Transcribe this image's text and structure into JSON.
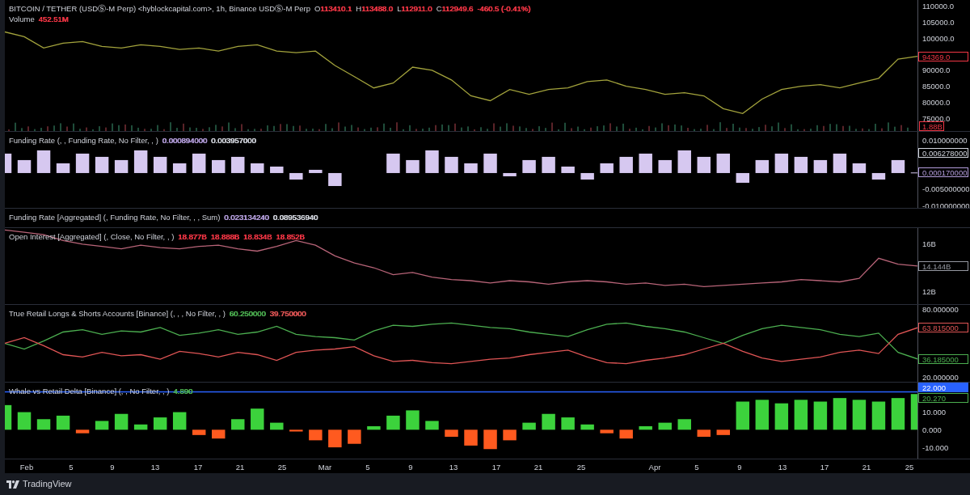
{
  "panes": [
    {
      "kind": "price",
      "legend": {
        "title": "BITCOIN / TETHER (USDⓈ-M Perp) <hyblockcapital.com>, 1h, Binance USDⓈ-M Perp",
        "values": [
          {
            "label": "O",
            "text": "113410.1",
            "color": "#f23645"
          },
          {
            "label": "H",
            "text": "113488.0",
            "color": "#f23645"
          },
          {
            "label": "L",
            "text": "112911.0",
            "color": "#f23645"
          },
          {
            "label": "C",
            "text": "112949.6",
            "color": "#f23645"
          },
          {
            "text": "-460.5 (-0.41%)",
            "color": "#f23645"
          }
        ]
      },
      "volume": {
        "title": "Volume",
        "value": "452.51M",
        "color": "#f23645",
        "badge": "1.88B"
      },
      "badges": [
        {
          "color": "#f23645"
        }
      ],
      "chart_data": {
        "type": "line",
        "ylim": [
          71000,
          112000
        ],
        "yticks": [
          {
            "value": 110000,
            "label": "110000.0"
          },
          {
            "value": 105000,
            "label": "105000.0"
          },
          {
            "value": 100000,
            "label": "100000.0"
          },
          {
            "value": 90000,
            "label": "90000.0"
          },
          {
            "value": 85000,
            "label": "85000.0"
          },
          {
            "value": 80000,
            "label": "80000.0"
          },
          {
            "value": 75000,
            "label": "75000.0"
          }
        ],
        "series": [
          {
            "color": "#a3a33c",
            "values": [
              102000,
              100500,
              97000,
              98500,
              99000,
              97500,
              97000,
              98000,
              97500,
              96500,
              97000,
              96000,
              97500,
              98000,
              96000,
              95500,
              96000,
              91500,
              88000,
              84500,
              86000,
              91000,
              90000,
              87000,
              82000,
              80500,
              84000,
              82500,
              84000,
              84500,
              86500,
              87000,
              85000,
              84000,
              82500,
              83000,
              82000,
              78000,
              76500,
              81000,
              84000,
              85000,
              85500,
              84500,
              86000,
              87500,
              93500,
              94369
            ]
          }
        ],
        "annotations": [
          "94369.0"
        ]
      }
    },
    {
      "kind": "bars",
      "legend": {
        "title": "Funding Rate (, , Funding Rate, No Filter, , )",
        "values": [
          {
            "text": "0.000894000",
            "color": "#b39ddb"
          },
          {
            "text": "0.003957000",
            "color": "#d1d4dc"
          }
        ]
      },
      "badges": [
        {
          "color": "#b39ddb"
        },
        {
          "color": "#d1d4dc"
        }
      ],
      "chart_data": {
        "type": "bar",
        "ylim": [
          -0.010741,
          0.012716
        ],
        "yticks": [
          {
            "value": 0.01,
            "label": "0.010000000"
          },
          {
            "value": -0.005,
            "label": "-0.005000000"
          },
          {
            "value": -0.01,
            "label": "-0.010000000"
          }
        ],
        "series": [
          {
            "color": "#d6c8f0",
            "values": [
              0.006,
              0.004,
              0.007,
              0.003,
              0.006,
              0.005,
              0.004,
              0.007,
              0.005,
              0.003,
              0.006,
              0.004,
              0.005,
              0.003,
              0.002,
              -0.002,
              0.001,
              -0.004,
              null,
              null,
              0.006,
              0.004,
              0.007,
              0.005,
              0.003,
              0.006,
              -0.001,
              0.004,
              0.005,
              0.002,
              -0.002,
              0.003,
              0.005,
              0.006,
              0.004,
              0.007,
              0.005,
              0.006,
              -0.003,
              0.004,
              0.006,
              0.005,
              0.004,
              0.006,
              0.003,
              -0.002,
              0.004,
              0.00017
            ]
          }
        ],
        "annotations": [
          "0.000170000",
          "0.006278000"
        ]
      }
    },
    {
      "kind": "legend",
      "legend": {
        "title": "Funding Rate [Aggregated] (, Funding Rate, No Filter, , , Sum)",
        "values": [
          {
            "text": "0.023134240",
            "color": "#b39ddb"
          },
          {
            "text": "0.089536940",
            "color": "#d1d4dc"
          }
        ]
      }
    },
    {
      "kind": "lines",
      "legend": {
        "title": "Open Interest [Aggregated] (, Close, No Filter, , )",
        "values": [
          {
            "text": "18.877B",
            "color": "#f23645"
          },
          {
            "text": "18.888B",
            "color": "#f23645"
          },
          {
            "text": "18.834B",
            "color": "#f23645"
          },
          {
            "text": "18.852B",
            "color": "#f23645"
          }
        ]
      },
      "badges": [
        {
          "color": "#9598a1"
        }
      ],
      "chart_data": {
        "type": "line",
        "ylim": [
          10.915,
          17.356
        ],
        "yticks": [
          {
            "value": 16,
            "label": "16B"
          },
          {
            "value": 12,
            "label": "12B"
          }
        ],
        "series": [
          {
            "color": "#b86478",
            "values": [
              17.2,
              17.0,
              16.8,
              16.3,
              16.0,
              15.8,
              15.6,
              15.9,
              15.7,
              15.6,
              15.8,
              15.9,
              15.6,
              15.4,
              15.8,
              16.3,
              15.9,
              15.0,
              14.4,
              14.0,
              13.4,
              13.6,
              13.2,
              13.0,
              12.9,
              12.7,
              12.9,
              12.8,
              12.6,
              12.8,
              12.9,
              12.8,
              12.6,
              12.7,
              12.5,
              12.6,
              12.4,
              12.5,
              12.6,
              12.7,
              12.8,
              13.0,
              12.9,
              12.8,
              13.1,
              14.8,
              14.3,
              14.144
            ]
          }
        ],
        "annotations": [
          "14.144B"
        ]
      }
    },
    {
      "kind": "lines",
      "legend": {
        "title": "True Retail Longs & Shorts Accounts [Binance] (, , , No Filter, , )",
        "values": [
          {
            "text": "60.250000",
            "color": "#4caf50"
          },
          {
            "text": "39.750000",
            "color": "#e05555"
          }
        ]
      },
      "badges": [
        {
          "color": "#4caf50"
        },
        {
          "color": "#e05555"
        }
      ],
      "chart_data": {
        "type": "line",
        "ylim": [
          16,
          84
        ],
        "yticks": [
          {
            "value": 80,
            "label": "80.000000"
          },
          {
            "value": 20,
            "label": "20.000000"
          }
        ],
        "series": [
          {
            "color": "#4caf50",
            "values": [
              50,
              45,
              52,
              60,
              62,
              58,
              61,
              60,
              64,
              57,
              59,
              62,
              58,
              60,
              65,
              58,
              56,
              55,
              53,
              61,
              66,
              65,
              67,
              68,
              66,
              64,
              63,
              60,
              58,
              56,
              62,
              67,
              68,
              65,
              63,
              60,
              55,
              50,
              57,
              63,
              66,
              64,
              62,
              58,
              56,
              59,
              42,
              36.185
            ]
          },
          {
            "color": "#e05555",
            "values": [
              50,
              55,
              48,
              40,
              38,
              42,
              39,
              40,
              36,
              43,
              41,
              38,
              42,
              40,
              35,
              42,
              44,
              45,
              47,
              39,
              34,
              35,
              33,
              32,
              34,
              36,
              37,
              40,
              42,
              44,
              38,
              33,
              32,
              35,
              37,
              40,
              45,
              50,
              43,
              37,
              34,
              36,
              38,
              42,
              44,
              41,
              58,
              63.815
            ]
          }
        ],
        "annotations": [
          "36.185000",
          "63.815000"
        ]
      }
    },
    {
      "kind": "bars",
      "legend": {
        "title": "Whale vs Retail Delta [Binance] (, , No Filter, , )",
        "values": [
          {
            "text": "4.890",
            "color": "#4caf50"
          }
        ]
      },
      "badges": [
        {
          "color": "#4caf50"
        }
      ],
      "chart_data": {
        "type": "bar",
        "ylim": [
          -16.4,
          26.8
        ],
        "yticks": [
          {
            "value": 10,
            "label": "10.000"
          },
          {
            "value": 0,
            "label": "0.000"
          },
          {
            "value": -10,
            "label": "-10.000"
          }
        ],
        "series": [
          {
            "color": "#3cd23c",
            "values": [
              14,
              10,
              6,
              8,
              null,
              5,
              9,
              3,
              7,
              10,
              null,
              null,
              6,
              12,
              4,
              null,
              null,
              null,
              null,
              2,
              8,
              11,
              5,
              null,
              null,
              null,
              null,
              4,
              9,
              7,
              3,
              null,
              null,
              2,
              4,
              6,
              null,
              null,
              16,
              17,
              15,
              17,
              16,
              18,
              17,
              16,
              18,
              20.27
            ]
          },
          {
            "color": "#ff5a1f",
            "values": [
              null,
              null,
              null,
              null,
              -2,
              null,
              null,
              null,
              null,
              null,
              -3,
              -5,
              null,
              null,
              null,
              -1,
              -6,
              -10,
              -8,
              null,
              null,
              null,
              null,
              -4,
              -9,
              -11,
              -6,
              null,
              null,
              null,
              null,
              -2,
              -5,
              null,
              null,
              null,
              -4,
              -3,
              null,
              null,
              null,
              null,
              null,
              null,
              null,
              null,
              null,
              null
            ]
          }
        ],
        "annotations": [
          "20.270"
        ]
      },
      "alert": {
        "label": "22.000",
        "color": "#2962ff"
      }
    }
  ],
  "time_axis": {
    "labels": [
      "Feb",
      "5",
      "9",
      "13",
      "17",
      "21",
      "25",
      "Mar",
      "5",
      "9",
      "13",
      "17",
      "21",
      "25",
      "Apr",
      "5",
      "9",
      "13",
      "17",
      "21",
      "25"
    ]
  },
  "footer": {
    "brand": "TradingView"
  }
}
